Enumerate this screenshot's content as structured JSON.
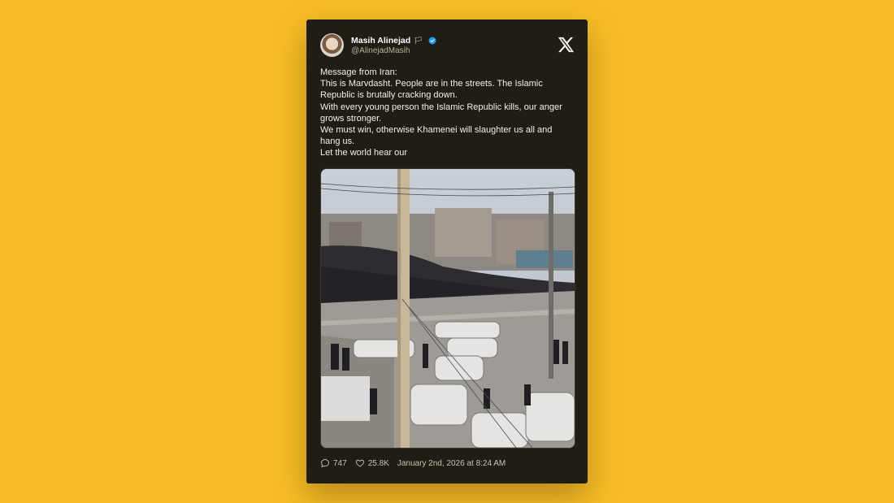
{
  "colors": {
    "background": "#f8bd25",
    "card": "#201d14",
    "verified": "#1d9bf0"
  },
  "author": {
    "name": "Masih Alinejad",
    "flag_icon": "white-flag-icon",
    "verified_icon": "verified-badge-icon",
    "handle": "@AlinejadMasih",
    "avatar": "profile-photo"
  },
  "platform_icon": "x-logo-icon",
  "tweet": {
    "lines": [
      "Message from Iran:",
      "This is Marvdasht. People are in the streets. The Islamic Republic is brutally cracking down.",
      "With every young person the Islamic Republic kills, our anger grows stronger.",
      "We must win, otherwise Khamenei will slaughter us all and hang us.",
      "Let the world hear our"
    ],
    "media": "street-protest-photo"
  },
  "footer": {
    "replies_icon": "comment-icon",
    "replies": "747",
    "likes_icon": "heart-icon",
    "likes": "25.8K",
    "timestamp": "January 2nd, 2026 at 8:24 AM"
  }
}
